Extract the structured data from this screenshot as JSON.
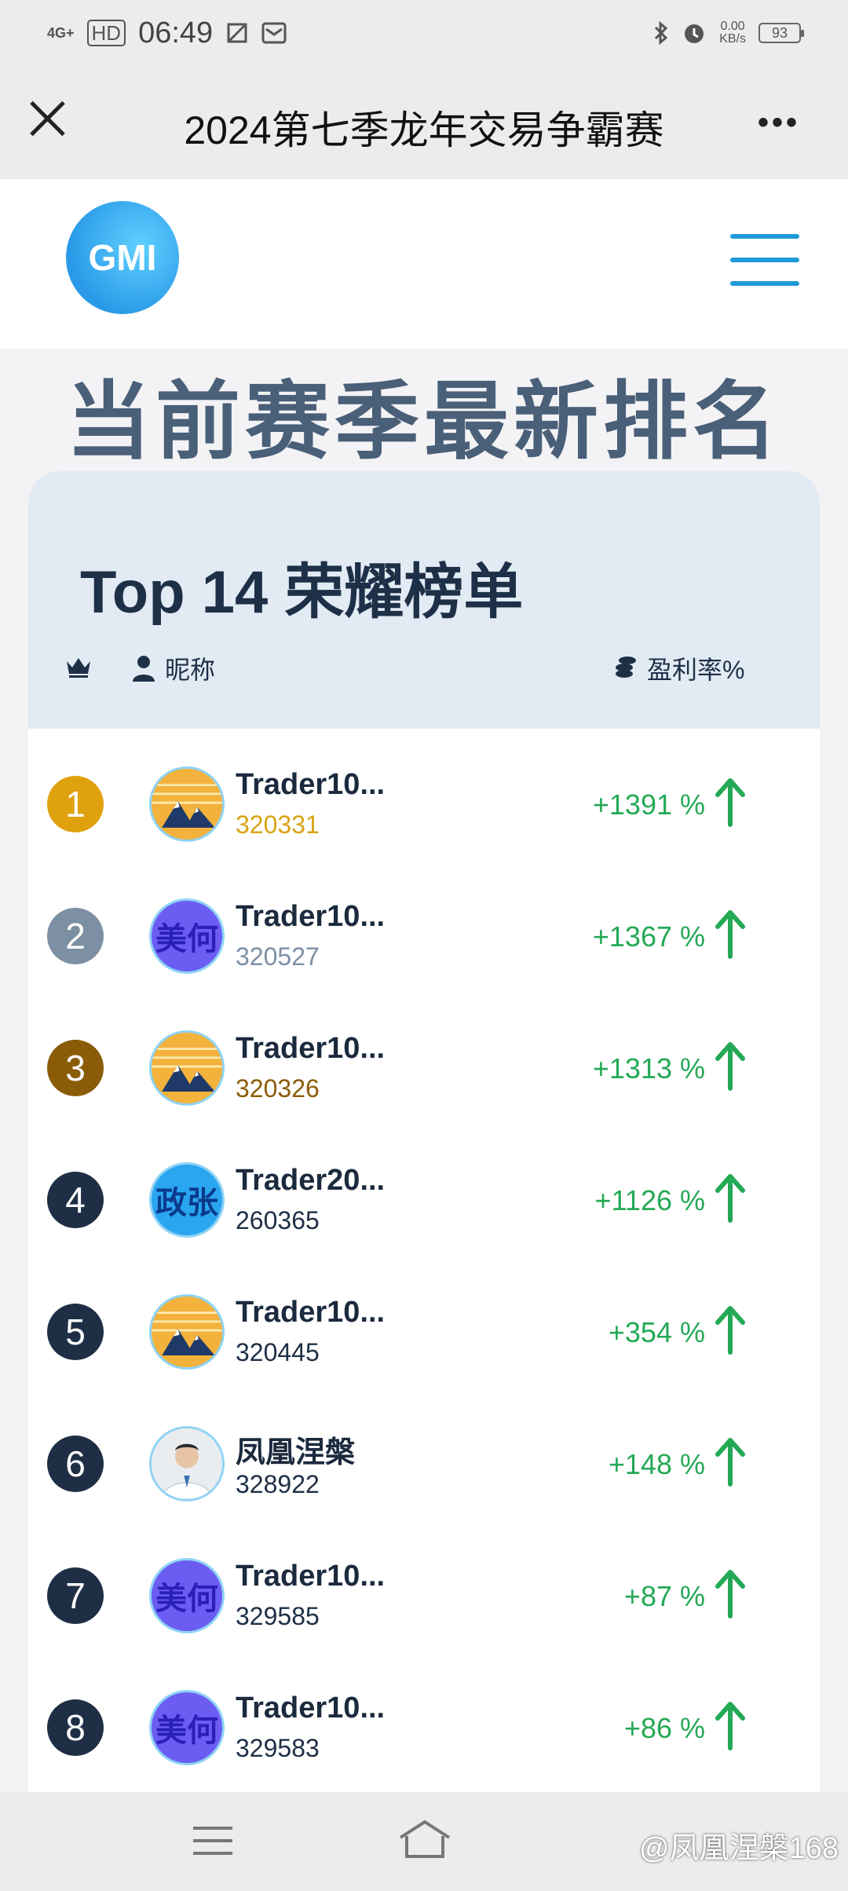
{
  "status_bar": {
    "network": "4G+",
    "hd": "HD",
    "time": "06:49",
    "speed_value": "0.00",
    "speed_unit": "KB/s",
    "battery": "93"
  },
  "title_bar": {
    "title": "2024第七季龙年交易争霸赛"
  },
  "header": {
    "logo_text": "GMI"
  },
  "section_heading": "当前赛季最新排名",
  "leaderboard": {
    "title": "Top 14 荣耀榜单",
    "col_nickname": "昵称",
    "col_rate": "盈利率%",
    "rows": [
      {
        "rank": "1",
        "name": "Trader10...",
        "id": "320331",
        "rate": "+1391 %",
        "avatar": "mountain-avatar",
        "avatar_text": "",
        "rank_color": "#e0a10f",
        "id_color": "#d9a312"
      },
      {
        "rank": "2",
        "name": "Trader10...",
        "id": "320527",
        "rate": "+1367 %",
        "avatar": "meihe-avatar",
        "avatar_text": "美何",
        "rank_color": "#7c8fa3",
        "id_color": "#7c8fa3"
      },
      {
        "rank": "3",
        "name": "Trader10...",
        "id": "320326",
        "rate": "+1313 %",
        "avatar": "mountain-avatar",
        "avatar_text": "",
        "rank_color": "#8a5c08",
        "id_color": "#8a5c08"
      },
      {
        "rank": "4",
        "name": "Trader20...",
        "id": "260365",
        "rate": "+1126 %",
        "avatar": "zhengzhang-avatar",
        "avatar_text": "政张",
        "rank_color": "#1e2f45",
        "id_color": "#1e2f45"
      },
      {
        "rank": "5",
        "name": "Trader10...",
        "id": "320445",
        "rate": "+354 %",
        "avatar": "mountain-avatar",
        "avatar_text": "",
        "rank_color": "#1e2f45",
        "id_color": "#1e2f45"
      },
      {
        "rank": "6",
        "name": "凤凰涅槃",
        "id": "328922",
        "rate": "+148 %",
        "avatar": "photo-avatar",
        "avatar_text": "",
        "rank_color": "#1e2f45",
        "id_color": "#1e2f45"
      },
      {
        "rank": "7",
        "name": "Trader10...",
        "id": "329585",
        "rate": "+87 %",
        "avatar": "meihe-avatar",
        "avatar_text": "美何",
        "rank_color": "#1e2f45",
        "id_color": "#1e2f45"
      },
      {
        "rank": "8",
        "name": "Trader10...",
        "id": "329583",
        "rate": "+86 %",
        "avatar": "meihe-avatar",
        "avatar_text": "美何",
        "rank_color": "#1e2f45",
        "id_color": "#1e2f45"
      }
    ]
  },
  "watermark": "@凤凰涅槃168",
  "colors": {
    "accent": "#1f9bd8",
    "gain": "#24a957",
    "heading": "#4a5f78"
  }
}
